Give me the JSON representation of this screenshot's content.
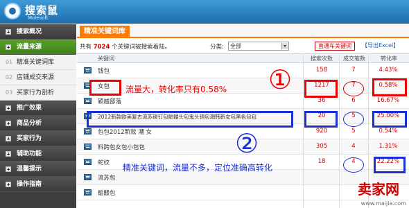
{
  "app": {
    "brand": "搜索鼠",
    "brand_sub": "Molesoft"
  },
  "sidebar": {
    "items": [
      {
        "label": "搜索概况"
      },
      {
        "label": "流量来源"
      },
      {
        "label": "精准关键词库",
        "num": "01"
      },
      {
        "label": "店铺成交来源",
        "num": "02"
      },
      {
        "label": "买家行为剖析",
        "num": "03"
      },
      {
        "label": "推广效果"
      },
      {
        "label": "商品分析"
      },
      {
        "label": "买家行为"
      },
      {
        "label": "辅助功能"
      },
      {
        "label": "温馨提示"
      },
      {
        "label": "操作指南"
      }
    ]
  },
  "main": {
    "title": "精准关键词库",
    "summary_prefix": "共有",
    "summary_count": "7024",
    "summary_suffix": "个关键词被搜索着陆。",
    "category_label": "分类:",
    "category_value": "全部",
    "btn_ztc": "直通车关键词",
    "btn_export": "【导出Excel】"
  },
  "table": {
    "headers": {
      "keyword": "关键词",
      "searches": "搜索次数",
      "deals": "成交笔数",
      "rate": "转化率"
    },
    "rows": [
      {
        "keyword": "钱包",
        "searches": "158",
        "deals": "7",
        "rate": "4.43%"
      },
      {
        "keyword": "女包",
        "searches": "1217",
        "deals": "7",
        "rate": "0.58%"
      },
      {
        "keyword": "颖越部落",
        "searches": "36",
        "deals": "6",
        "rate": "16.67%"
      },
      {
        "keyword": "2012新款欧美复古流苏铆钉包骷髅头包鬼头铜包潮韩新女包黑色包包",
        "searches": "20",
        "deals": "5",
        "rate": "25.00%"
      },
      {
        "keyword": "包包2012新款 潮 女",
        "searches": "920",
        "deals": "5",
        "rate": "0.54%"
      },
      {
        "keyword": "料跨包女包小包包",
        "searches": "305",
        "deals": "4",
        "rate": "1.31%"
      },
      {
        "keyword": "蛇纹",
        "searches": "18",
        "deals": "4",
        "rate": "22.22%"
      },
      {
        "keyword": "流苏包",
        "searches": "",
        "deals": "",
        "rate": ""
      },
      {
        "keyword": "骷髅包",
        "searches": "",
        "deals": "",
        "rate": ""
      }
    ]
  },
  "annotations": {
    "note1": "流量大，转化率只有0.58%",
    "note2": "精准关键词，流量不多，定位准确高转化",
    "num1": "①",
    "num2": "②"
  },
  "watermark": {
    "logo": "卖家网",
    "url": "www.maijia.com"
  },
  "colors": {
    "accent": "#ff7a00",
    "header": "#1f6fb0",
    "sidebar": "#3d3d3d",
    "active": "#4a8f20",
    "red": "#e00000",
    "blue": "#1a2fd8"
  }
}
